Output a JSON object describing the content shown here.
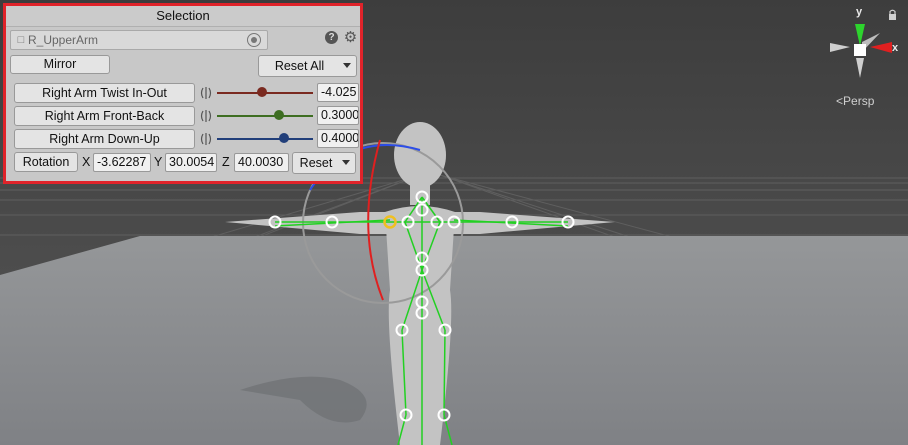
{
  "panel": {
    "title": "Selection",
    "object_field": {
      "value": "R_UpperArm"
    },
    "mirror_label": "Mirror",
    "reset_all_label": "Reset All",
    "muscles": [
      {
        "label": "Right Arm Twist In-Out",
        "value": "-4.025",
        "level": 0.47,
        "color": "#7a2a20"
      },
      {
        "label": "Right Arm Front-Back",
        "value": "0.3000",
        "level": 0.65,
        "color": "#3e6e22"
      },
      {
        "label": "Right Arm Down-Up",
        "value": "0.4000",
        "level": 0.7,
        "color": "#223f7a"
      }
    ],
    "rotation": {
      "label": "Rotation",
      "x_label": "X",
      "x_value": "-3.62287",
      "y_label": "Y",
      "y_value": "30.0054",
      "z_label": "Z",
      "z_value": "40.0030",
      "reset_label": "Reset"
    }
  },
  "scene": {
    "gizmo": {
      "y_label": "y",
      "x_label": "x",
      "view_mode": "Persp"
    },
    "colors": {
      "sky": "#454545",
      "grid": "#5a5a5a",
      "plane": "#8a8c8f",
      "figure": "#bdbdbd",
      "bone": "#22d022",
      "highlight": "#f0c020"
    }
  }
}
